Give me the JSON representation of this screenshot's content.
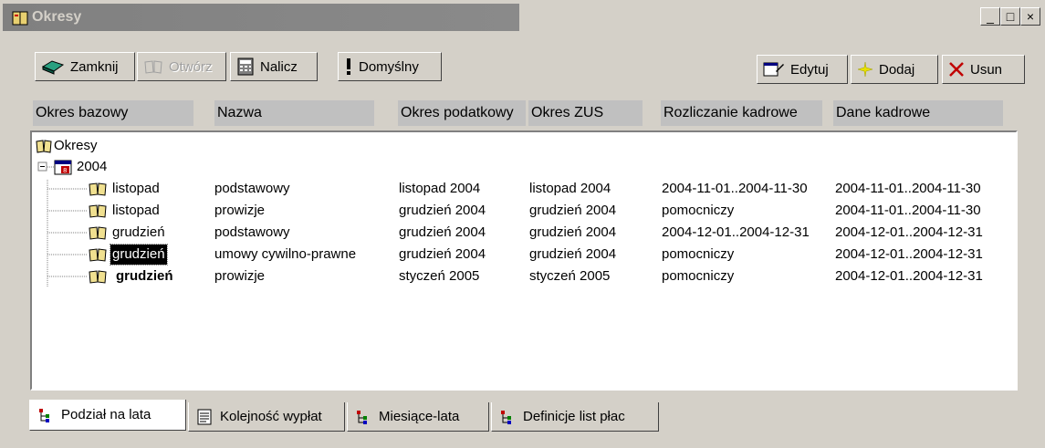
{
  "window": {
    "title": "Okresy",
    "controls": [
      "_",
      "□",
      "×"
    ]
  },
  "toolbar": {
    "close_label": "Zamknij",
    "open_label": "Otwórz",
    "compute_label": "Nalicz",
    "default_label": "Domyślny",
    "edit_label": "Edytuj",
    "add_label": "Dodaj",
    "delete_label": "Usun"
  },
  "columns": [
    "Okres bazowy",
    "Nazwa",
    "Okres podatkowy",
    "Okres ZUS",
    "Rozliczanie kadrowe",
    "Dane kadrowe"
  ],
  "tree": {
    "root_label": "Okresy",
    "year_label": "2004",
    "rows": [
      {
        "okres": "listopad",
        "nazwa": "podstawowy",
        "podatkowy": "listopad 2004",
        "zus": "listopad 2004",
        "rozliczanie": "2004-11-01..2004-11-30",
        "dane": "2004-11-01..2004-11-30"
      },
      {
        "okres": "listopad",
        "nazwa": "prowizje",
        "podatkowy": "grudzień 2004",
        "zus": "grudzień 2004",
        "rozliczanie": "pomocniczy",
        "dane": "2004-11-01..2004-11-30"
      },
      {
        "okres": "grudzień",
        "nazwa": "podstawowy",
        "podatkowy": "grudzień 2004",
        "zus": "grudzień 2004",
        "rozliczanie": "2004-12-01..2004-12-31",
        "dane": "2004-12-01..2004-12-31"
      },
      {
        "okres": "grudzień",
        "nazwa": "umowy cywilno-prawne",
        "podatkowy": "grudzień 2004",
        "zus": "grudzień 2004",
        "rozliczanie": "pomocniczy",
        "dane": "2004-12-01..2004-12-31"
      },
      {
        "okres": "grudzień",
        "nazwa": "prowizje",
        "podatkowy": "styczeń 2005",
        "zus": "styczeń 2005",
        "rozliczanie": "pomocniczy",
        "dane": "2004-12-01..2004-12-31"
      }
    ]
  },
  "tabs": [
    "Podział na lata",
    "Kolejność wypłat",
    "Miesiące-lata",
    "Definicje list płac"
  ]
}
